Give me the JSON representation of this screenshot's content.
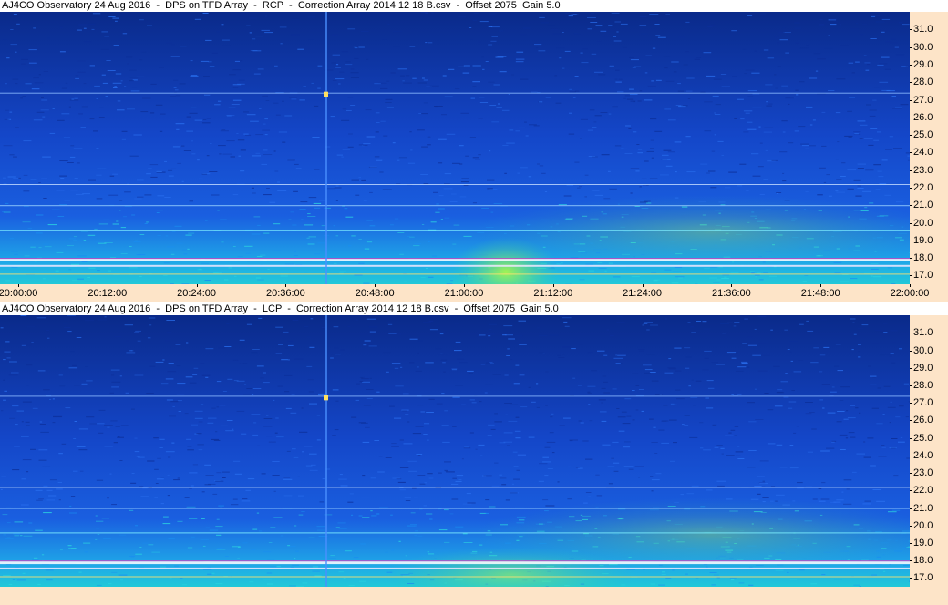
{
  "colors": {
    "axis_bg": "#fde4c8",
    "deep": "#0a2a8a",
    "mid": "#1a5fe0",
    "hot": "#b8ff3a"
  },
  "panels": [
    {
      "title": "AJ4CO Observatory 24 Aug 2016  -  DPS on TFD Array  -  RCP  -  Correction Array 2014 12 18 B.csv  -  Offset 2075  Gain 5.0"
    },
    {
      "title": "AJ4CO Observatory 24 Aug 2016  -  DPS on TFD Array  -  LCP  -  Correction Array 2014 12 18 B.csv  -  Offset 2075  Gain 5.0"
    }
  ],
  "chart_data": [
    {
      "type": "heatmap",
      "title": "AJ4CO Observatory 24 Aug 2016  -  DPS on TFD Array  -  RCP  -  Correction Array 2014 12 18 B.csv  -  Offset 2075  Gain 5.0",
      "x_ticks": [
        "20:00:00",
        "20:12:00",
        "20:24:00",
        "20:36:00",
        "20:48:00",
        "21:00:00",
        "21:12:00",
        "21:24:00",
        "21:36:00",
        "21:48:00",
        "22:00:00"
      ],
      "y_ticks": [
        "17.0",
        "18.0",
        "19.0",
        "20.0",
        "21.0",
        "22.0",
        "23.0",
        "24.0",
        "25.0",
        "26.0",
        "27.0",
        "28.0",
        "29.0",
        "30.0",
        "31.0"
      ],
      "xlim": [
        "20:00:00",
        "22:00:00"
      ],
      "ylim": [
        16.5,
        32.0
      ]
    },
    {
      "type": "heatmap",
      "title": "AJ4CO Observatory 24 Aug 2016  -  DPS on TFD Array  -  LCP  -  Correction Array 2014 12 18 B.csv  -  Offset 2075  Gain 5.0",
      "x_ticks": [],
      "y_ticks": [
        "17.0",
        "18.0",
        "19.0",
        "20.0",
        "21.0",
        "22.0",
        "23.0",
        "24.0",
        "25.0",
        "26.0",
        "27.0",
        "28.0",
        "29.0",
        "30.0",
        "31.0"
      ],
      "xlim": [
        "20:00:00",
        "22:00:00"
      ],
      "ylim": [
        16.5,
        32.0
      ]
    }
  ]
}
